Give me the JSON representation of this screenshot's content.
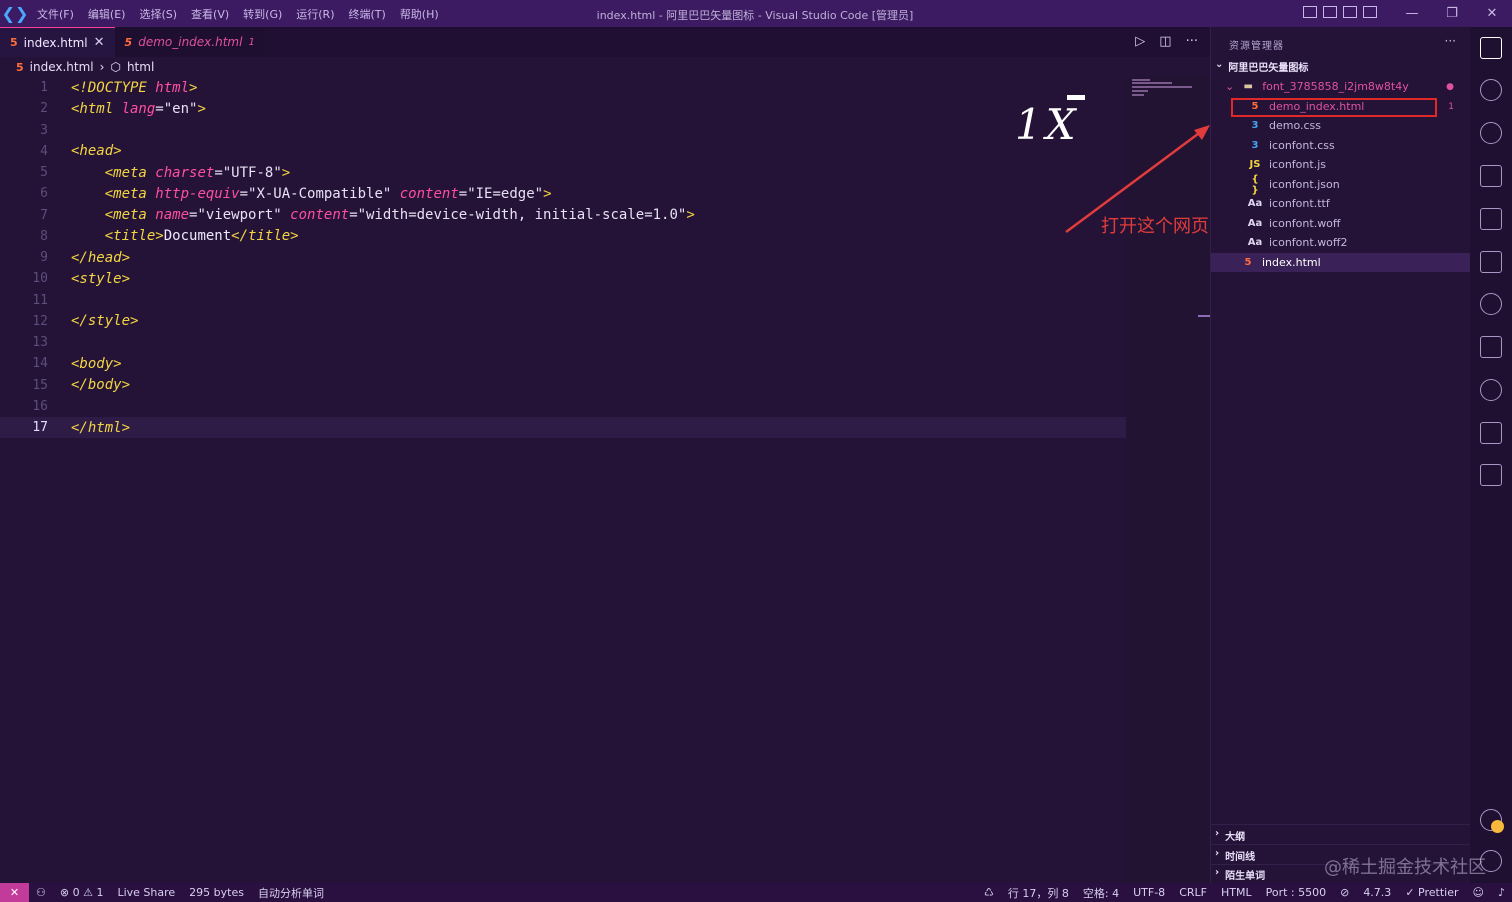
{
  "titlebar": {
    "menu": [
      "文件(F)",
      "编辑(E)",
      "选择(S)",
      "查看(V)",
      "转到(G)",
      "运行(R)",
      "终端(T)",
      "帮助(H)"
    ],
    "window_title": "index.html - 阿里巴巴矢量图标 - Visual Studio Code [管理员]"
  },
  "tabs": [
    {
      "label": "index.html",
      "state": "active"
    },
    {
      "label": "demo_index.html",
      "badge": "1",
      "state": "inactive"
    }
  ],
  "breadcrumb": {
    "file": "index.html",
    "symbol": "html"
  },
  "editor": {
    "lines": [
      {
        "n": "1",
        "segments": [
          [
            "t-doc",
            "<!DOCTYPE "
          ],
          [
            "t-attr",
            "html"
          ],
          [
            "t-doc",
            ">"
          ]
        ]
      },
      {
        "n": "2",
        "segments": [
          [
            "t-tag",
            "<html "
          ],
          [
            "t-attr",
            "lang"
          ],
          [
            "t-str",
            "=\"en\""
          ],
          [
            "t-tag",
            ">"
          ]
        ]
      },
      {
        "n": "3",
        "segments": []
      },
      {
        "n": "4",
        "segments": [
          [
            "t-tag",
            "<head>"
          ]
        ]
      },
      {
        "n": "5",
        "segments": [
          [
            "t-txt",
            "    "
          ],
          [
            "t-tag",
            "<meta "
          ],
          [
            "t-attr",
            "charset"
          ],
          [
            "t-str",
            "=\"UTF-8\""
          ],
          [
            "t-tag",
            ">"
          ]
        ]
      },
      {
        "n": "6",
        "segments": [
          [
            "t-txt",
            "    "
          ],
          [
            "t-tag",
            "<meta "
          ],
          [
            "t-attr",
            "http-equiv"
          ],
          [
            "t-str",
            "=\"X-UA-Compatible\" "
          ],
          [
            "t-attr",
            "content"
          ],
          [
            "t-str",
            "=\"IE=edge\""
          ],
          [
            "t-tag",
            ">"
          ]
        ]
      },
      {
        "n": "7",
        "segments": [
          [
            "t-txt",
            "    "
          ],
          [
            "t-tag",
            "<meta "
          ],
          [
            "t-attr",
            "name"
          ],
          [
            "t-str",
            "=\"viewport\" "
          ],
          [
            "t-attr",
            "content"
          ],
          [
            "t-str",
            "=\"width=device-width, initial-scale=1.0\""
          ],
          [
            "t-tag",
            ">"
          ]
        ]
      },
      {
        "n": "8",
        "segments": [
          [
            "t-txt",
            "    "
          ],
          [
            "t-tag",
            "<title>"
          ],
          [
            "t-txt",
            "Document"
          ],
          [
            "t-tag",
            "</title>"
          ]
        ]
      },
      {
        "n": "9",
        "segments": [
          [
            "t-tag",
            "</head>"
          ]
        ]
      },
      {
        "n": "10",
        "segments": [
          [
            "t-tag",
            "<style>"
          ]
        ]
      },
      {
        "n": "11",
        "segments": []
      },
      {
        "n": "12",
        "segments": [
          [
            "t-tag",
            "</style>"
          ]
        ]
      },
      {
        "n": "13",
        "segments": []
      },
      {
        "n": "14",
        "segments": [
          [
            "t-tag",
            "<body>"
          ]
        ]
      },
      {
        "n": "15",
        "segments": [
          [
            "t-tag",
            "</body>"
          ]
        ]
      },
      {
        "n": "16",
        "segments": []
      },
      {
        "n": "17",
        "segments": [
          [
            "t-tag",
            "</html>"
          ]
        ],
        "current": true
      }
    ]
  },
  "overlay": {
    "zoom_label": "1X",
    "annotation": "打开这个网页"
  },
  "sidebar": {
    "title": "资源管理器",
    "section": "阿里巴巴矢量图标",
    "folder": "font_3785858_i2jm8w8t4y",
    "files": [
      {
        "icon": "5",
        "name": "demo_index.html",
        "badge": "1",
        "kind": "html",
        "highlighted": true
      },
      {
        "icon": "3",
        "name": "demo.css",
        "kind": "css"
      },
      {
        "icon": "3",
        "name": "iconfont.css",
        "kind": "css"
      },
      {
        "icon": "JS",
        "name": "iconfont.js",
        "kind": "js"
      },
      {
        "icon": "{ }",
        "name": "iconfont.json",
        "kind": "json"
      },
      {
        "icon": "Aa",
        "name": "iconfont.ttf",
        "kind": "font"
      },
      {
        "icon": "Aa",
        "name": "iconfont.woff",
        "kind": "font"
      },
      {
        "icon": "Aa",
        "name": "iconfont.woff2",
        "kind": "font"
      }
    ],
    "root_file": "index.html",
    "bottom_sections": [
      "大纲",
      "时间线",
      "陌生单词"
    ]
  },
  "statusbar": {
    "left": [
      "⊗ 0 ⚠ 1",
      "Live Share",
      "295 bytes",
      "自动分析单词"
    ],
    "right": [
      "行 17，列 8",
      "空格: 4",
      "UTF-8",
      "CRLF",
      "HTML",
      "Port : 5500",
      "4.7.3",
      "✓ Prettier"
    ]
  },
  "watermark": "@稀土掘金技术社区",
  "colors": {
    "accent": "#ff3f9e",
    "tag": "#f3d542",
    "attr": "#ff4fa0",
    "annotation": "#e23b3b"
  }
}
